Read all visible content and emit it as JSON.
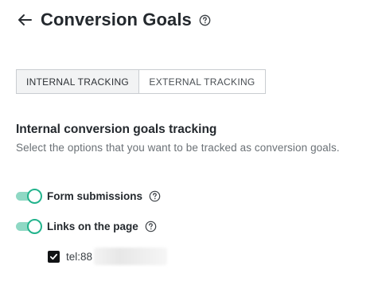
{
  "header": {
    "back_icon": "arrow-left-icon",
    "title": "Conversion Goals",
    "help_icon": "question-circle-icon"
  },
  "tabs": [
    {
      "label": "INTERNAL TRACKING",
      "active": true
    },
    {
      "label": "EXTERNAL TRACKING",
      "active": false
    }
  ],
  "section": {
    "title": "Internal conversion goals tracking",
    "description": "Select the options that you want to be tracked as conversion goals."
  },
  "options": [
    {
      "label": "Form submissions",
      "enabled": true,
      "help_icon": "question-circle-icon"
    },
    {
      "label": "Links on the page",
      "enabled": true,
      "help_icon": "question-circle-icon"
    }
  ],
  "links": [
    {
      "label": "tel:88",
      "checked": true
    }
  ],
  "colors": {
    "toggle_track": "#8fd8c4",
    "toggle_knob_border": "#22b38c",
    "checkbox_fill": "#111315",
    "text_primary": "#24292e",
    "text_secondary": "#6b7176"
  }
}
